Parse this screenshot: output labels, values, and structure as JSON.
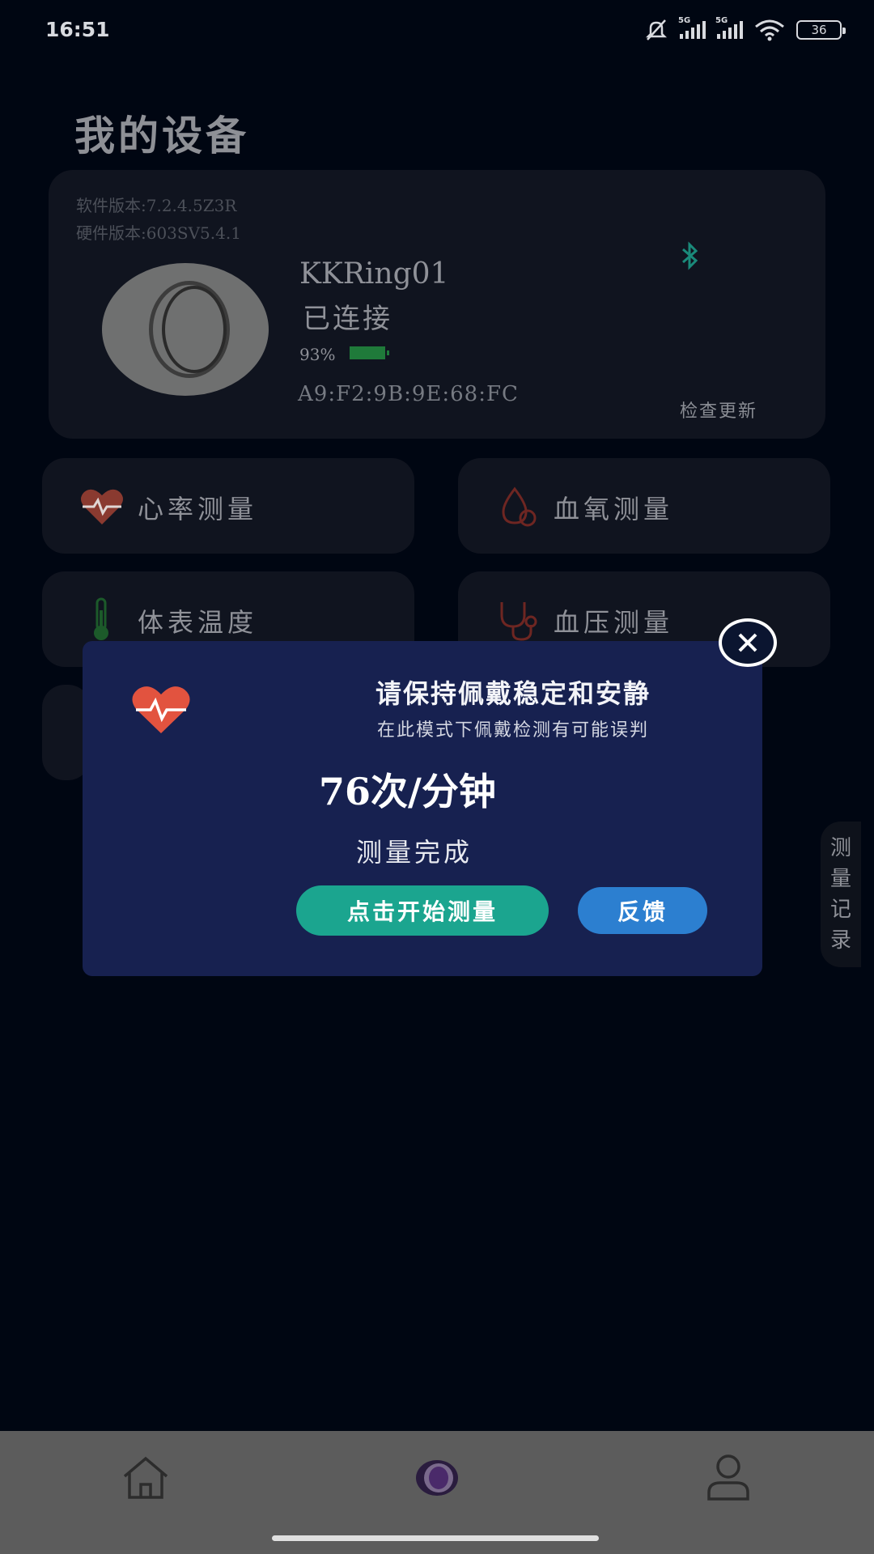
{
  "status_bar": {
    "time": "16:51",
    "network_1": "5G",
    "network_2": "5G",
    "battery": "36",
    "icons": [
      "mute-bell-icon",
      "signal-icon",
      "signal-icon",
      "wifi-icon",
      "battery-icon"
    ]
  },
  "page": {
    "title": "我的设备"
  },
  "device": {
    "software_version": "软件版本:7.2.4.5Z3R",
    "hardware_version": "硬件版本:603SV5.4.1",
    "name": "KKRing01",
    "connection_status": "已连接",
    "battery_percent": "93%",
    "battery_level": 0.93,
    "mac_address": "A9:F2:9B:9E:68:FC",
    "check_update_label": "检查更新"
  },
  "tiles": [
    {
      "label": "心率测量",
      "icon": "heart-rate-icon"
    },
    {
      "label": "血氧测量",
      "icon": "blood-drop-icon"
    },
    {
      "label": "体表温度",
      "icon": "thermometer-icon"
    },
    {
      "label": "血压测量",
      "icon": "stethoscope-icon"
    }
  ],
  "side_tab": {
    "chars": [
      "测",
      "量",
      "记",
      "录"
    ]
  },
  "modal": {
    "title": "请保持佩戴稳定和安静",
    "subtitle": "在此模式下佩戴检测有可能误判",
    "result": "76次/分钟",
    "status": "测量完成",
    "start_button": "点击开始测量",
    "feedback_button": "反馈"
  },
  "colors": {
    "background": "#000612",
    "modal": "#172150",
    "start_button": "#1ba58f",
    "feedback_button": "#2c7fd0",
    "heart": "#e2533f"
  },
  "bottom_nav": {
    "items": [
      "home-icon",
      "ring-icon",
      "profile-icon"
    ]
  }
}
